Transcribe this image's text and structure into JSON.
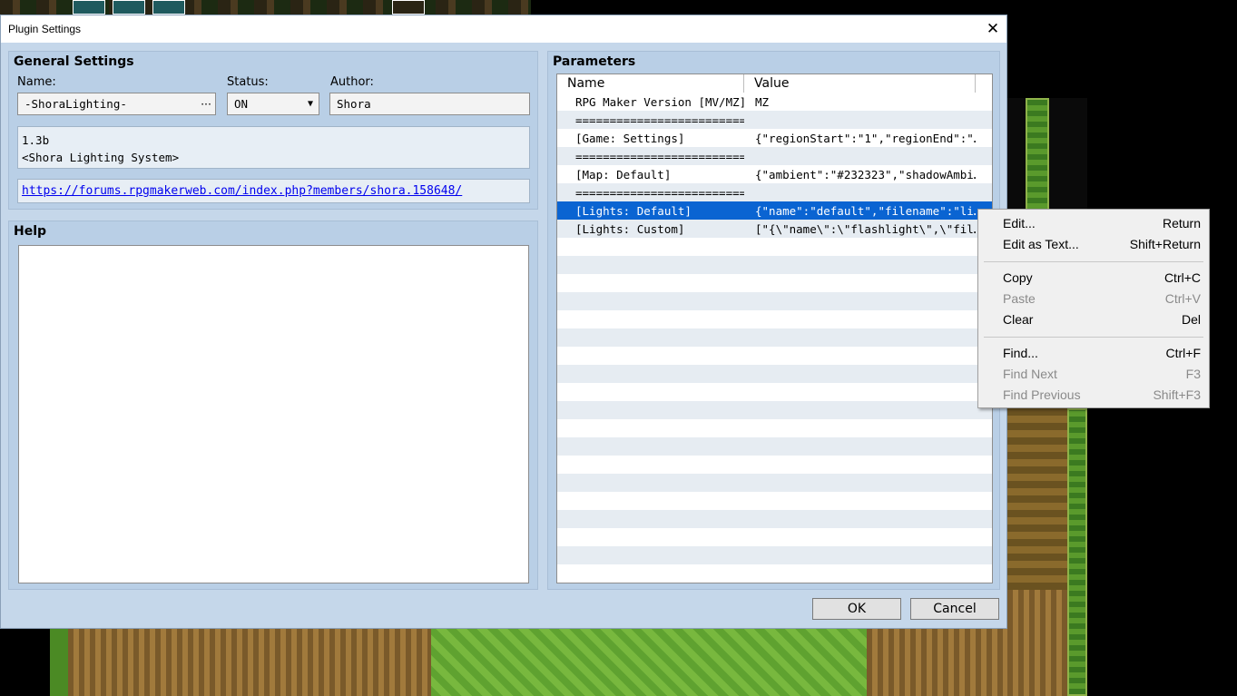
{
  "window": {
    "title": "Plugin Settings",
    "close_glyph": "✕"
  },
  "general": {
    "title": "General Settings",
    "name_label": "Name:",
    "name_value": "-ShoraLighting-",
    "name_button": "···",
    "status_label": "Status:",
    "status_value": "ON",
    "author_label": "Author:",
    "author_value": "Shora",
    "description_line1": "1.3b",
    "description_line2": "<Shora Lighting System>",
    "url": "https://forums.rpgmakerweb.com/index.php?members/shora.158648/"
  },
  "help": {
    "title": "Help"
  },
  "parameters": {
    "title": "Parameters",
    "columns": [
      "Name",
      "Value"
    ],
    "rows": [
      {
        "name": "RPG Maker Version [MV/MZ]",
        "value": "MZ"
      },
      {
        "name": "=========================",
        "value": ""
      },
      {
        "name": "[Game: Settings]",
        "value": "{\"regionStart\":\"1\",\"regionEnd\":\"…"
      },
      {
        "name": "=========================",
        "value": ""
      },
      {
        "name": "[Map: Default]",
        "value": "{\"ambient\":\"#232323\",\"shadowAmbi…"
      },
      {
        "name": "=========================",
        "value": ""
      },
      {
        "name": "[Lights: Default]",
        "value": "{\"name\":\"default\",\"filename\":\"li…",
        "selected": true
      },
      {
        "name": "[Lights: Custom]",
        "value": "[\"{\\\"name\\\":\\\"flashlight\\\",\\\"fil…"
      }
    ]
  },
  "buttons": {
    "ok": "OK",
    "cancel": "Cancel"
  },
  "context_menu": {
    "items": [
      {
        "label": "Edit...",
        "shortcut": "Return",
        "enabled": true
      },
      {
        "label": "Edit as Text...",
        "shortcut": "Shift+Return",
        "enabled": true
      },
      {
        "label": "Copy",
        "shortcut": "Ctrl+C",
        "enabled": true
      },
      {
        "label": "Paste",
        "shortcut": "Ctrl+V",
        "enabled": false
      },
      {
        "label": "Clear",
        "shortcut": "Del",
        "enabled": true
      },
      {
        "label": "Find...",
        "shortcut": "Ctrl+F",
        "enabled": true
      },
      {
        "label": "Find Next",
        "shortcut": "F3",
        "enabled": false
      },
      {
        "label": "Find Previous",
        "shortcut": "Shift+F3",
        "enabled": false
      }
    ]
  },
  "colors": {
    "selection": "#0a64d2",
    "dialog_bg": "#c5d7ea",
    "group_bg": "#b9cfe6"
  }
}
